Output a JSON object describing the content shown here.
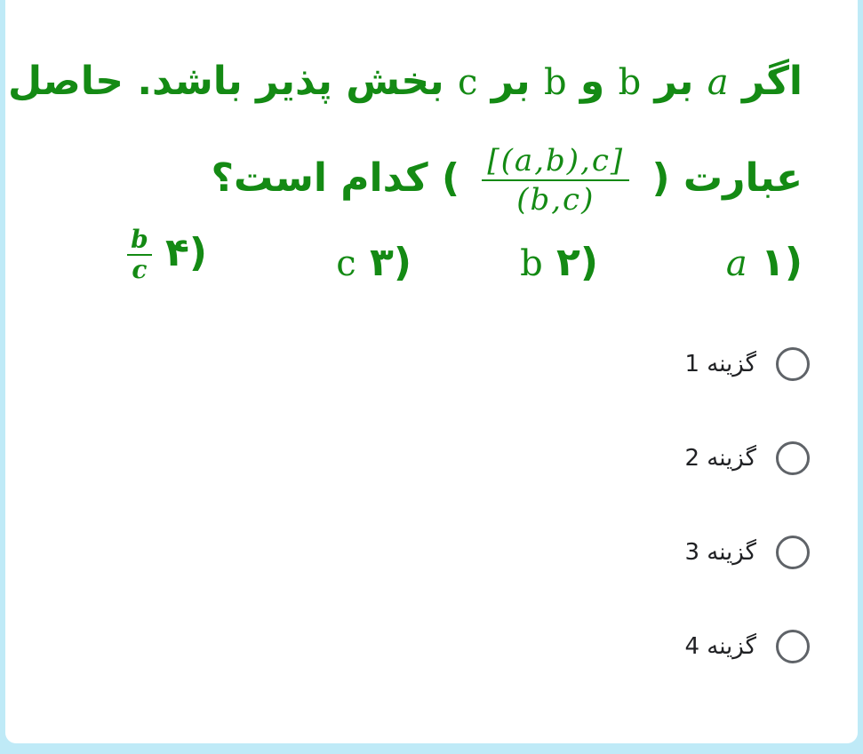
{
  "question": {
    "line1": {
      "w1": "اگر",
      "a": "a",
      "w2": "بر",
      "b": "b",
      "w3": "و",
      "b2": "b",
      "w4": "بر",
      "c": "c",
      "w5": "بخش پذیر باشد. حاصل"
    },
    "line2": {
      "w1": "عبارت (",
      "numerator": "[(a,b),c]",
      "denominator": "(b,c)",
      "w2": ") کدام است؟"
    },
    "choices": [
      {
        "num": "(۱",
        "value": "a"
      },
      {
        "num": "(۲",
        "value": "b"
      },
      {
        "num": "(۳",
        "value": "c"
      },
      {
        "num": "(۴",
        "frac_num": "b",
        "frac_den": "c"
      }
    ]
  },
  "options": [
    {
      "label": "گزینه 1"
    },
    {
      "label": "گزینه 2"
    },
    {
      "label": "گزینه 3"
    },
    {
      "label": "گزینه 4"
    }
  ],
  "colors": {
    "question_text": "#148a14",
    "background": "#bfeaf7",
    "radio_border": "#5f6368"
  }
}
